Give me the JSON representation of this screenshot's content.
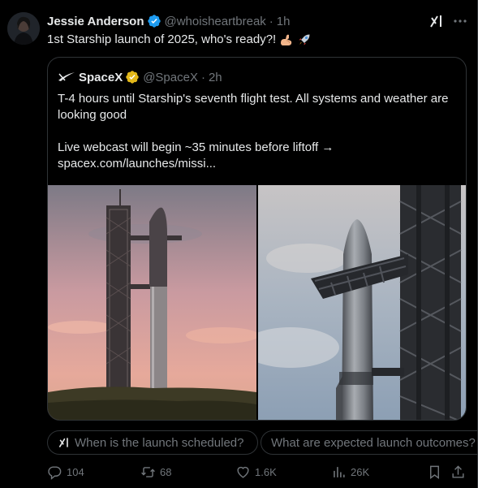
{
  "post": {
    "author_name": "Jessie Anderson",
    "handle": "@whoisheartbreak",
    "separator": "·",
    "time": "1h",
    "text": "1st Starship launch of 2025, who's ready?!",
    "emojis": [
      "flexed-arm-icon",
      "rocket-icon"
    ]
  },
  "quote": {
    "author_name": "SpaceX",
    "handle": "@SpaceX",
    "separator": "·",
    "time": "2h",
    "line1": "T-4 hours until Starship's seventh flight test. All systems and weather are looking good",
    "line2": "Live webcast will begin ~35 minutes before liftoff →",
    "link": "spacex.com/launches/missi..."
  },
  "grok_suggestions": [
    "When is the launch scheduled?",
    "What are expected launch outcomes?"
  ],
  "actions": {
    "replies": "104",
    "reposts": "68",
    "likes": "1.6K",
    "views": "26K"
  },
  "colors": {
    "background": "#000000",
    "text": "#e7e9ea",
    "muted": "#71767b",
    "border": "#2f3336",
    "verified_blue": "#1d9bf0",
    "verified_gold": "#e2b719"
  }
}
